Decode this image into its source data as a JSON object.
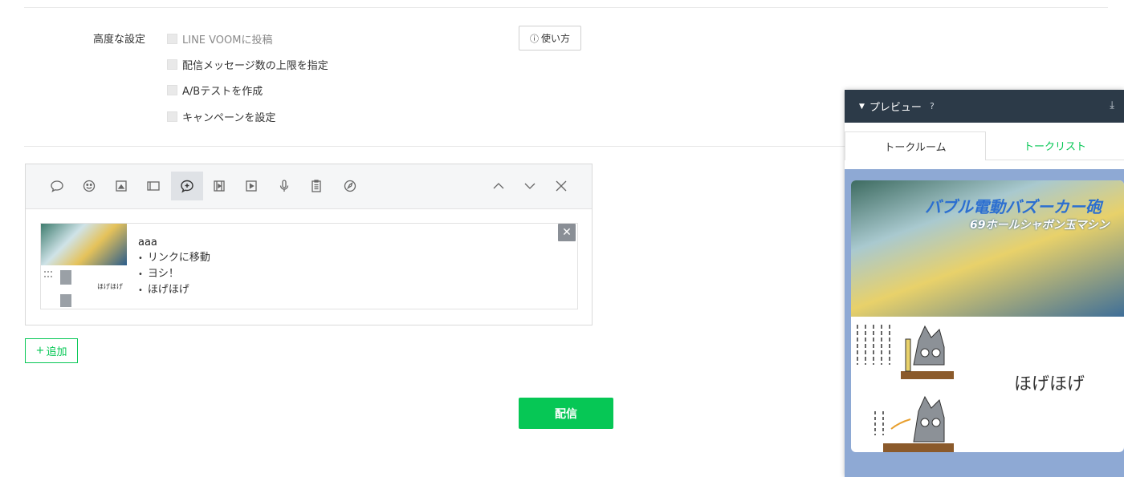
{
  "advanced": {
    "label": "高度な設定",
    "options": [
      {
        "label": "LINE VOOMに投稿",
        "disabled": true
      },
      {
        "label": "配信メッセージ数の上限を指定",
        "disabled": false
      },
      {
        "label": "A/Bテストを作成",
        "disabled": false
      },
      {
        "label": "キャンペーンを設定",
        "disabled": false
      }
    ],
    "howto_label": "使い方"
  },
  "toolbar": {
    "icons": [
      "text-icon",
      "sticker-icon",
      "image-icon",
      "coupon-icon",
      "cardtype-icon",
      "video-icon",
      "richvideo-icon",
      "voice-icon",
      "research-icon",
      "richmessage-icon"
    ],
    "active": "cardtype-icon"
  },
  "card": {
    "title": "aaa",
    "items": [
      "リンクに移動",
      "ヨシ！",
      "ほげほげ"
    ],
    "thumb_caption": "ほげほげ"
  },
  "add_button": "追加",
  "send_button": "配信",
  "preview": {
    "title": "プレビュー",
    "tabs": [
      "トークルーム",
      "トークリスト"
    ],
    "image_text_1": "バブル電動バズーカー砲",
    "image_text_2": "69ホールシャボン玉マシン",
    "caption": "ほげほげ"
  },
  "colors": {
    "accent": "#06c755",
    "header": "#2c3a48"
  }
}
